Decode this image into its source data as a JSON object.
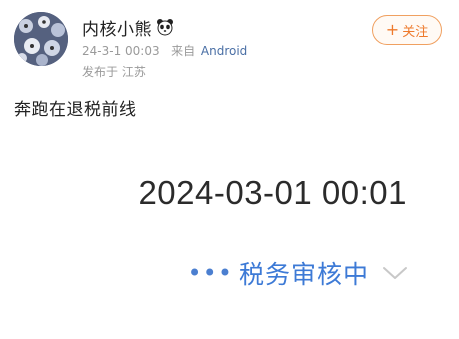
{
  "post": {
    "user_name": "内核小熊",
    "name_badge_icon": "panda-icon",
    "timestamp": "24-3-1 00:03",
    "source_prefix": "来自",
    "source_name": "Android",
    "location": "发布于 江苏",
    "follow_label": "关注",
    "text": "奔跑在退税前线"
  },
  "embedded_screenshot": {
    "datetime": "2024-03-01 00:01",
    "status_dots": "•••",
    "status_text": "税务审核中",
    "expand_icon": "chevron-down-icon"
  },
  "colors": {
    "follow_accent": "#ee7a2c",
    "link_blue": "#4a6fa5",
    "status_blue": "#3d7ad6"
  }
}
